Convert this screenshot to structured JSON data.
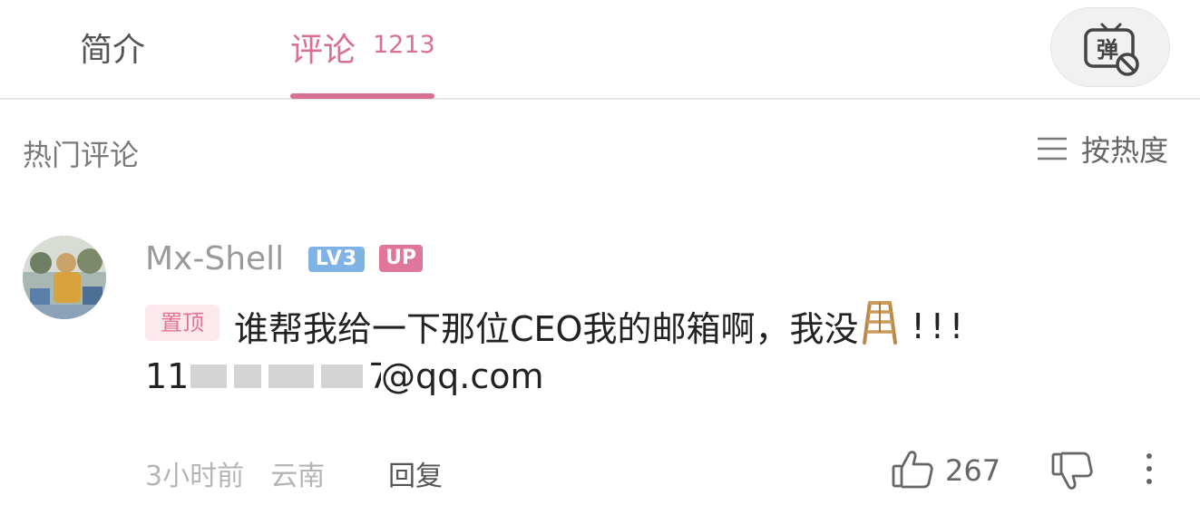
{
  "tabs": {
    "intro_label": "简介",
    "comments_label": "评论",
    "comments_count": "1213",
    "active_color": "#d86f95"
  },
  "danmaku": {
    "icon": "danmaku-off-icon",
    "glyph": "弹"
  },
  "section": {
    "title": "热门评论",
    "sort_label": "按热度",
    "sort_icon": "sort-lines-icon"
  },
  "comment": {
    "username": "Mx-Shell",
    "level_badge": "LV3",
    "up_badge": "UP",
    "pinned_tag": "置顶",
    "text": "谁帮我给一下那位CEO我的邮箱啊，我没",
    "ladder_icon": "ladder-icon",
    "exclamation": "!!!",
    "email_visible_prefix": "11c",
    "email_visible_suffix": "7",
    "email_domain": "@qq.com",
    "time": "3小时前",
    "location": "云南",
    "reply_label": "回复",
    "likes": "267"
  },
  "icons": [
    "thumb-up-icon",
    "thumb-down-icon",
    "more-vertical-icon"
  ]
}
